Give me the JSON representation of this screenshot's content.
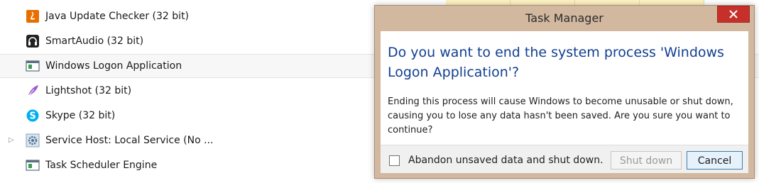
{
  "processes": [
    {
      "name": "Java Update Checker (32 bit)",
      "icon": "java-icon",
      "expandable": false,
      "selected": false
    },
    {
      "name": "SmartAudio (32 bit)",
      "icon": "headphones-icon",
      "expandable": false,
      "selected": false
    },
    {
      "name": "Windows Logon Application",
      "icon": "app-window-icon",
      "expandable": false,
      "selected": true
    },
    {
      "name": "Lightshot (32 bit)",
      "icon": "feather-icon",
      "expandable": false,
      "selected": false
    },
    {
      "name": "Skype (32 bit)",
      "icon": "skype-icon",
      "expandable": false,
      "selected": false
    },
    {
      "name": "Service Host: Local Service (No ...",
      "icon": "gear-icon",
      "expandable": true,
      "selected": false
    },
    {
      "name": "Task Scheduler Engine",
      "icon": "app-window-icon",
      "expandable": false,
      "selected": false
    }
  ],
  "dialog": {
    "title": "Task Manager",
    "close_icon": "close-icon",
    "instruction": "Do you want to end the system process 'Windows Logon Application'?",
    "content": "Ending this process will cause Windows to become unusable or shut down, causing you to lose any data hasn't been saved. Are you sure you want to continue?",
    "checkbox_label": "Abandon unsaved data and shut down.",
    "checkbox_checked": false,
    "shutdown_label": "Shut down",
    "shutdown_enabled": false,
    "cancel_label": "Cancel"
  },
  "colors": {
    "dialog_frame": "#d3b8a0",
    "close_button": "#c7302a",
    "instruction_text": "#103f91",
    "cancel_border": "#3c7fb1"
  }
}
